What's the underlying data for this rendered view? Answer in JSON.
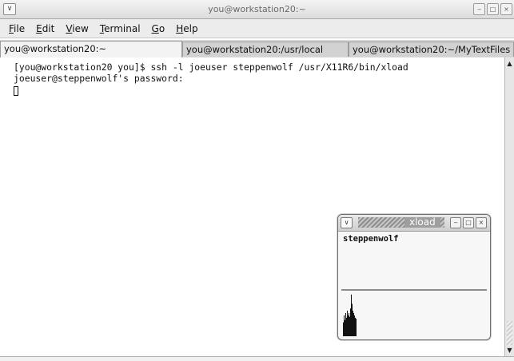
{
  "window": {
    "title": "you@workstation20:~",
    "menu_glyph": "∨",
    "minimize_glyph": "‒",
    "maximize_glyph": "□",
    "close_glyph": "×"
  },
  "menubar": {
    "items": [
      {
        "label": "File",
        "mnemonic": "F",
        "rest": "ile"
      },
      {
        "label": "Edit",
        "mnemonic": "E",
        "rest": "dit"
      },
      {
        "label": "View",
        "mnemonic": "V",
        "rest": "iew"
      },
      {
        "label": "Terminal",
        "mnemonic": "T",
        "rest": "erminal"
      },
      {
        "label": "Go",
        "mnemonic": "G",
        "rest": "o"
      },
      {
        "label": "Help",
        "mnemonic": "H",
        "rest": "elp"
      }
    ]
  },
  "tabs": [
    {
      "label": "you@workstation20:~",
      "active": true
    },
    {
      "label": "you@workstation20:/usr/local",
      "active": false
    },
    {
      "label": "you@workstation20:~/MyTextFiles",
      "active": false
    }
  ],
  "terminal": {
    "lines": [
      "[you@workstation20 you]$ ssh -l joeuser steppenwolf /usr/X11R6/bin/xload",
      "joeuser@steppenwolf's password:"
    ]
  },
  "scrollbar": {
    "up_glyph": "▲",
    "down_glyph": "▼"
  },
  "xload": {
    "title": "xload",
    "hostname": "steppenwolf",
    "load_scale": 1,
    "load_history": [
      0.0,
      0.0,
      0.3,
      0.45,
      0.35,
      0.5,
      0.4,
      0.55,
      0.45,
      0.5,
      0.42,
      0.6,
      0.9,
      0.7,
      0.55,
      0.5,
      0.45,
      0.4,
      0.38
    ],
    "graph_color": "#111111"
  }
}
